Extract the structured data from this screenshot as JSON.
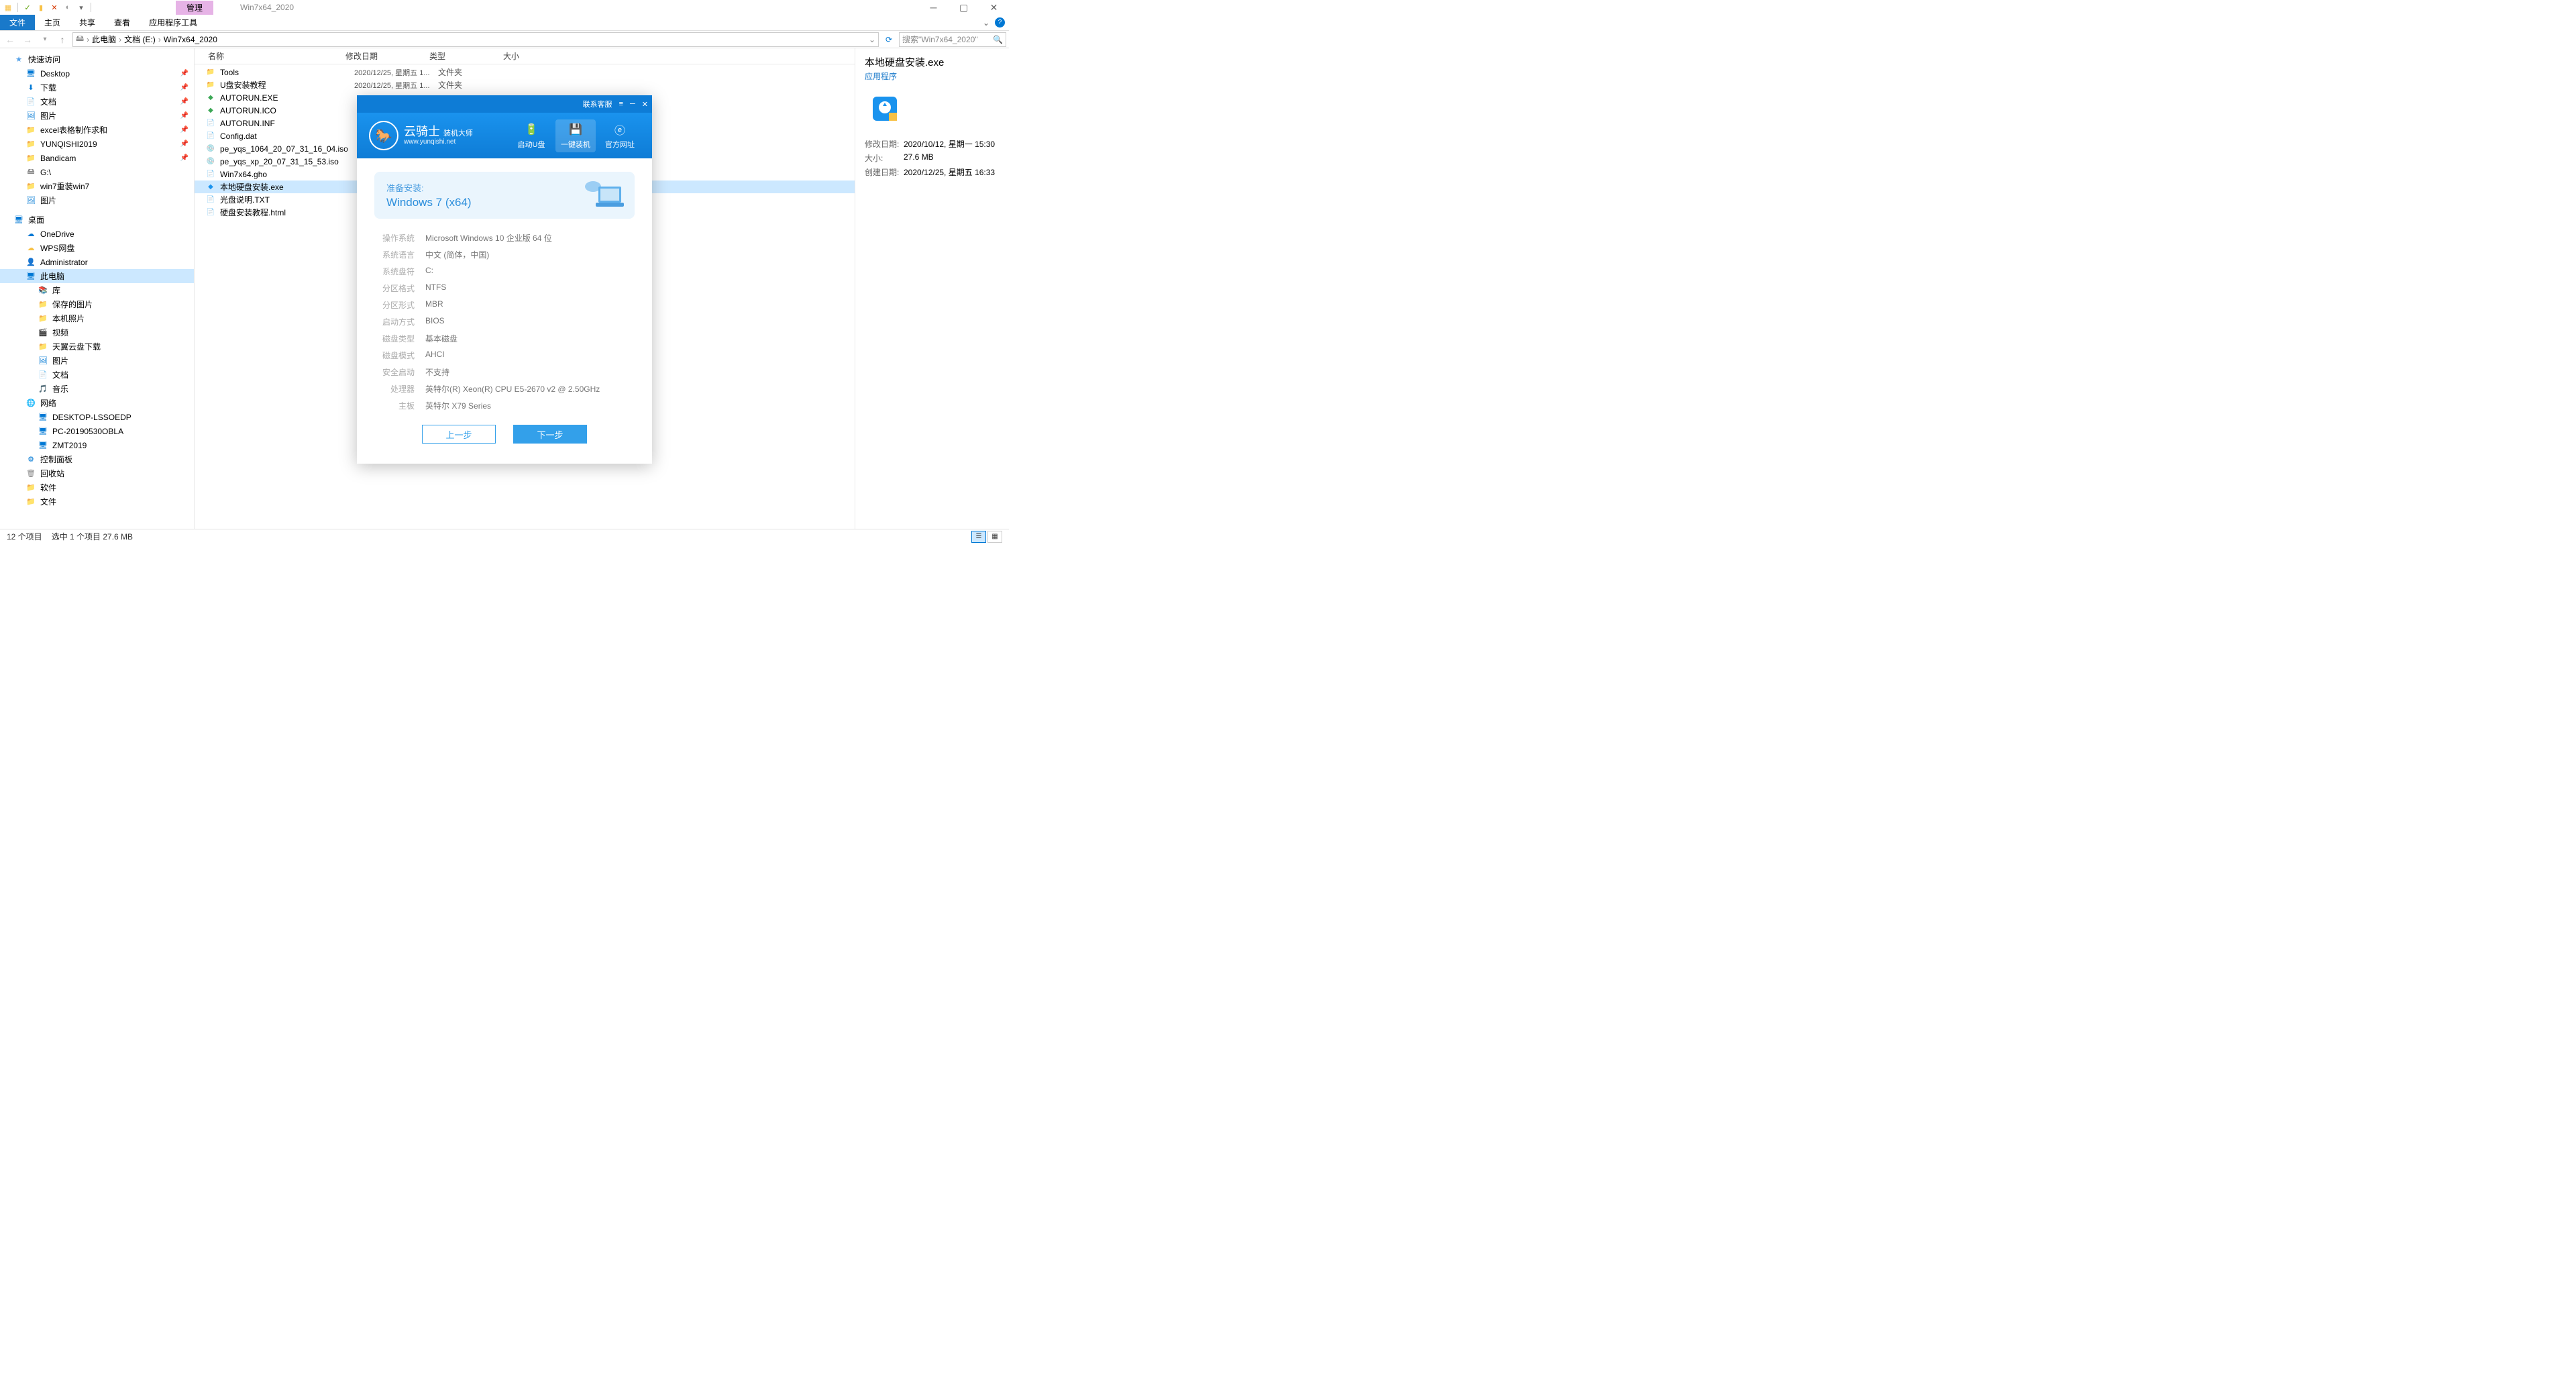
{
  "window": {
    "manage_tab": "管理",
    "title": "Win7x64_2020"
  },
  "ribbon": {
    "file": "文件",
    "home": "主页",
    "share": "共享",
    "view": "查看",
    "apptools": "应用程序工具"
  },
  "breadcrumb": {
    "pc": "此电脑",
    "drive": "文档 (E:)",
    "folder": "Win7x64_2020"
  },
  "search": {
    "placeholder": "搜索\"Win7x64_2020\""
  },
  "columns": {
    "name": "名称",
    "date": "修改日期",
    "type": "类型",
    "size": "大小"
  },
  "sidebar": {
    "quick": "快速访问",
    "desktop_label": "桌面",
    "items_quick": [
      "Desktop",
      "下载",
      "文档",
      "图片",
      "excel表格制作求和",
      "YUNQISHI2019",
      "Bandicam",
      "G:\\",
      "win7重装win7",
      "图片"
    ],
    "desktop_items": [
      "OneDrive",
      "WPS网盘",
      "Administrator",
      "此电脑",
      "库",
      "保存的图片",
      "本机照片",
      "视频",
      "天翼云盘下载",
      "图片",
      "文档",
      "音乐",
      "网络",
      "DESKTOP-LSSOEDP",
      "PC-20190530OBLA",
      "ZMT2019",
      "控制面板",
      "回收站",
      "软件",
      "文件"
    ]
  },
  "files": [
    {
      "name": "Tools",
      "date": "2020/12/25, 星期五 1...",
      "type": "文件夹",
      "icon": "folder"
    },
    {
      "name": "U盘安装教程",
      "date": "2020/12/25, 星期五 1...",
      "type": "文件夹",
      "icon": "folder"
    },
    {
      "name": "AUTORUN.EXE",
      "date": "",
      "type": "",
      "icon": "exe-g"
    },
    {
      "name": "AUTORUN.ICO",
      "date": "",
      "type": "",
      "icon": "ico-g"
    },
    {
      "name": "AUTORUN.INF",
      "date": "",
      "type": "",
      "icon": "txt"
    },
    {
      "name": "Config.dat",
      "date": "",
      "type": "",
      "icon": "txt"
    },
    {
      "name": "pe_yqs_1064_20_07_31_16_04.iso",
      "date": "",
      "type": "",
      "icon": "iso"
    },
    {
      "name": "pe_yqs_xp_20_07_31_15_53.iso",
      "date": "",
      "type": "",
      "icon": "iso"
    },
    {
      "name": "Win7x64.gho",
      "date": "",
      "type": "",
      "icon": "txt"
    },
    {
      "name": "本地硬盘安装.exe",
      "date": "",
      "type": "",
      "icon": "exe-b",
      "selected": true
    },
    {
      "name": "光盘说明.TXT",
      "date": "",
      "type": "",
      "icon": "txt"
    },
    {
      "name": "硬盘安装教程.html",
      "date": "",
      "type": "",
      "icon": "txt"
    }
  ],
  "details": {
    "title": "本地硬盘安装.exe",
    "subtitle": "应用程序",
    "rows": [
      {
        "label": "修改日期:",
        "value": "2020/10/12, 星期一 15:30"
      },
      {
        "label": "大小:",
        "value": "27.6 MB"
      },
      {
        "label": "创建日期:",
        "value": "2020/12/25, 星期五 16:33"
      }
    ]
  },
  "status": {
    "count": "12 个项目",
    "sel": "选中 1 个项目  27.6 MB"
  },
  "dialog": {
    "contact": "联系客服",
    "logo_main": "云骑士",
    "logo_sub1": "装机大师",
    "logo_sub2": "www.yunqishi.net",
    "nav": [
      "启动U盘",
      "一键装机",
      "官方网址"
    ],
    "prep_title": "准备安装:",
    "prep_os": "Windows 7 (x64)",
    "info": [
      {
        "label": "操作系统",
        "value": "Microsoft Windows 10 企业版 64 位"
      },
      {
        "label": "系统语言",
        "value": "中文 (简体，中国)"
      },
      {
        "label": "系统盘符",
        "value": "C:"
      },
      {
        "label": "分区格式",
        "value": "NTFS"
      },
      {
        "label": "分区形式",
        "value": "MBR"
      },
      {
        "label": "启动方式",
        "value": "BIOS"
      },
      {
        "label": "磁盘类型",
        "value": "基本磁盘"
      },
      {
        "label": "磁盘模式",
        "value": "AHCI"
      },
      {
        "label": "安全启动",
        "value": "不支持"
      },
      {
        "label": "处理器",
        "value": "英特尔(R) Xeon(R) CPU E5-2670 v2 @ 2.50GHz"
      },
      {
        "label": "主板",
        "value": "英特尔 X79 Series"
      }
    ],
    "btn_prev": "上一步",
    "btn_next": "下一步"
  }
}
